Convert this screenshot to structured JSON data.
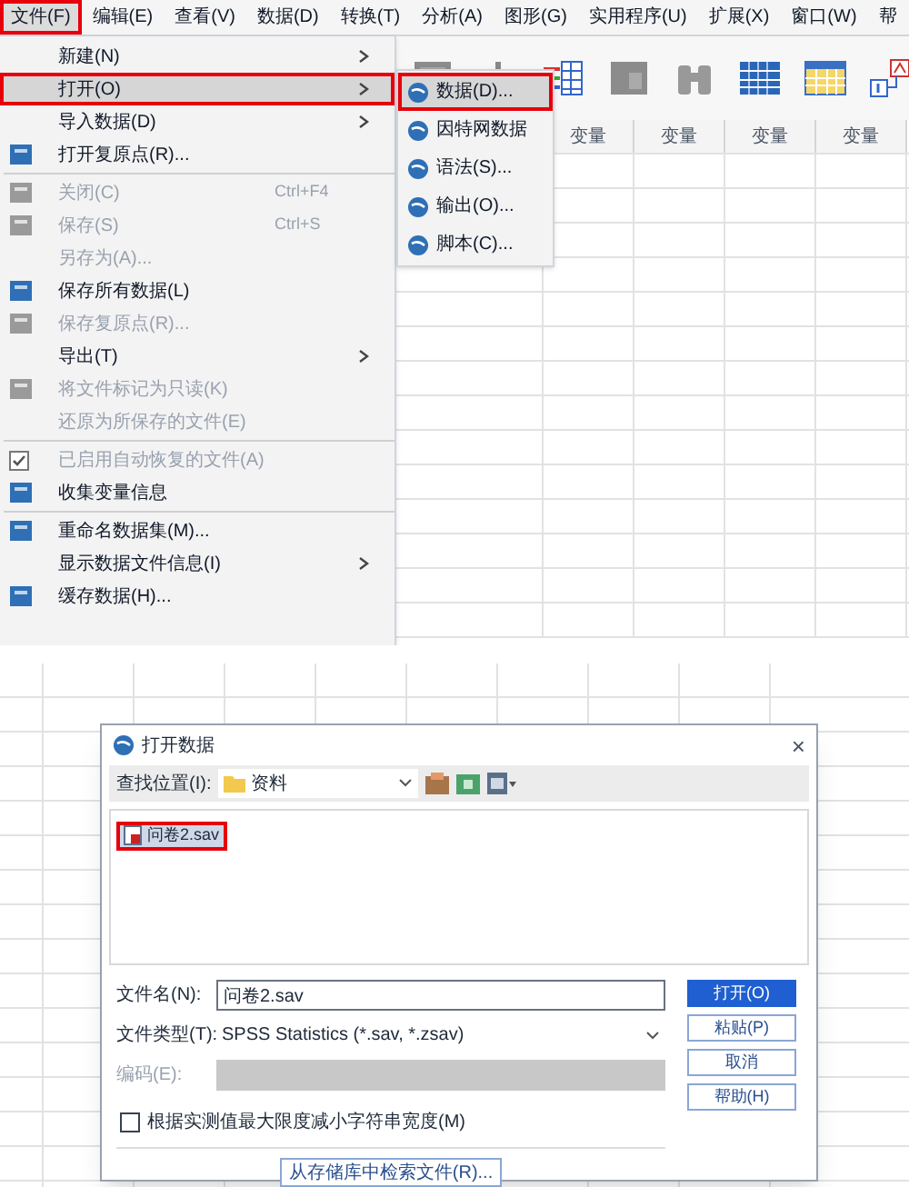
{
  "menu_bar": [
    {
      "label": "文件(F)",
      "selected": true
    },
    {
      "label": "编辑(E)",
      "selected": false
    },
    {
      "label": "查看(V)",
      "selected": false
    },
    {
      "label": "数据(D)",
      "selected": false
    },
    {
      "label": "转换(T)",
      "selected": false
    },
    {
      "label": "分析(A)",
      "selected": false
    },
    {
      "label": "图形(G)",
      "selected": false
    },
    {
      "label": "实用程序(U)",
      "selected": false
    },
    {
      "label": "扩展(X)",
      "selected": false
    },
    {
      "label": "窗口(W)",
      "selected": false
    },
    {
      "label": "帮",
      "selected": false
    }
  ],
  "file_menu": [
    {
      "kind": "item",
      "label": "新建(N)",
      "disabled": false,
      "submenu": true,
      "selected": false,
      "checked": false,
      "icon": false
    },
    {
      "kind": "item",
      "label": "打开(O)",
      "disabled": false,
      "submenu": true,
      "selected": true,
      "checked": false,
      "icon": false
    },
    {
      "kind": "item",
      "label": "导入数据(D)",
      "disabled": false,
      "submenu": true,
      "selected": false,
      "checked": false,
      "icon": false
    },
    {
      "kind": "item",
      "label": "打开复原点(R)...",
      "disabled": false,
      "submenu": false,
      "selected": false,
      "checked": false,
      "icon": true
    },
    {
      "kind": "separator"
    },
    {
      "kind": "item",
      "label": "关闭(C)",
      "shortcut": "Ctrl+F4",
      "disabled": true,
      "submenu": false,
      "selected": false,
      "checked": false,
      "icon": true
    },
    {
      "kind": "item",
      "label": "保存(S)",
      "shortcut": "Ctrl+S",
      "disabled": true,
      "submenu": false,
      "selected": false,
      "checked": false,
      "icon": true
    },
    {
      "kind": "item",
      "label": "另存为(A)...",
      "disabled": true,
      "submenu": false,
      "selected": false,
      "checked": false,
      "icon": false
    },
    {
      "kind": "item",
      "label": "保存所有数据(L)",
      "disabled": false,
      "submenu": false,
      "selected": false,
      "checked": false,
      "icon": true
    },
    {
      "kind": "item",
      "label": "保存复原点(R)...",
      "disabled": true,
      "submenu": false,
      "selected": false,
      "checked": false,
      "icon": true
    },
    {
      "kind": "item",
      "label": "导出(T)",
      "disabled": false,
      "submenu": true,
      "selected": false,
      "checked": false,
      "icon": false
    },
    {
      "kind": "item",
      "label": "将文件标记为只读(K)",
      "disabled": true,
      "submenu": false,
      "selected": false,
      "checked": false,
      "icon": true
    },
    {
      "kind": "item",
      "label": "还原为所保存的文件(E)",
      "disabled": true,
      "submenu": false,
      "selected": false,
      "checked": false,
      "icon": false
    },
    {
      "kind": "separator"
    },
    {
      "kind": "item",
      "label": "已启用自动恢复的文件(A)",
      "disabled": true,
      "submenu": false,
      "selected": false,
      "checked": true,
      "icon": false
    },
    {
      "kind": "item",
      "label": "收集变量信息",
      "disabled": false,
      "submenu": false,
      "selected": false,
      "checked": false,
      "icon": true
    },
    {
      "kind": "separator"
    },
    {
      "kind": "item",
      "label": "重命名数据集(M)...",
      "disabled": false,
      "submenu": false,
      "selected": false,
      "checked": false,
      "icon": true
    },
    {
      "kind": "item",
      "label": "显示数据文件信息(I)",
      "disabled": false,
      "submenu": true,
      "selected": false,
      "checked": false,
      "icon": false
    },
    {
      "kind": "item",
      "label": "缓存数据(H)...",
      "disabled": false,
      "submenu": false,
      "selected": false,
      "checked": false,
      "icon": true
    }
  ],
  "open_submenu": [
    {
      "label": "数据(D)...",
      "selected": true
    },
    {
      "label": "因特网数据",
      "selected": false
    },
    {
      "label": "语法(S)...",
      "selected": false
    },
    {
      "label": "输出(O)...",
      "selected": false
    },
    {
      "label": "脚本(C)...",
      "selected": false
    }
  ],
  "grid": {
    "columns": [
      "变量",
      "变量",
      "变量",
      "变量"
    ]
  },
  "dialog": {
    "title": "打开数据",
    "close": "×",
    "look_in_label": "查找位置(I):",
    "look_in_value": "资料",
    "files": [
      {
        "name": "问卷2.sav",
        "selected": true
      }
    ],
    "file_name_label": "文件名(N):",
    "file_name_value": "问卷2.sav",
    "file_type_label": "文件类型(T):",
    "file_type_value": "SPSS Statistics (*.sav, *.zsav)",
    "encoding_label": "编码(E):",
    "checkbox": {
      "label": "根据实测值最大限度减小字符串宽度(M)",
      "checked": false
    },
    "retrieve_button": "从存储库中检索文件(R)...",
    "buttons": [
      {
        "label": "打开(O)",
        "default": true
      },
      {
        "label": "粘贴(P)",
        "default": false
      },
      {
        "label": "取消",
        "default": false
      },
      {
        "label": "帮助(H)",
        "default": false
      }
    ]
  }
}
